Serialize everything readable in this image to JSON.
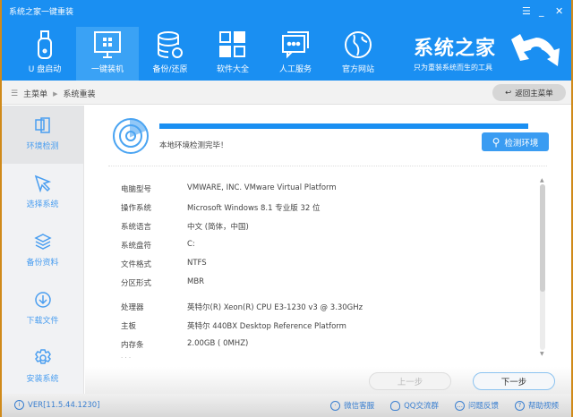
{
  "window": {
    "title": "系统之家一键重装",
    "menu_icon": "menu-icon",
    "min_icon": "minimize-icon",
    "close_icon": "close-icon"
  },
  "nav": [
    {
      "label": "U 盘启动",
      "icon": "usb-icon"
    },
    {
      "label": "一键装机",
      "icon": "monitor-windows-icon",
      "selected": true
    },
    {
      "label": "备份/还原",
      "icon": "database-restore-icon"
    },
    {
      "label": "软件大全",
      "icon": "apps-grid-icon"
    },
    {
      "label": "人工服务",
      "icon": "chat-icon"
    },
    {
      "label": "官方网站",
      "icon": "globe-icon"
    }
  ],
  "brand": {
    "name": "系统之家",
    "slogan": "只为重装系统而生的工具"
  },
  "breadcrumb": {
    "root": "主菜单",
    "current": "系统重装"
  },
  "back_button": "返回主菜单",
  "sidebar": [
    {
      "label": "环境检测",
      "icon": "devices-icon",
      "selected": true
    },
    {
      "label": "选择系统",
      "icon": "cursor-icon"
    },
    {
      "label": "备份资料",
      "icon": "layers-icon"
    },
    {
      "label": "下载文件",
      "icon": "download-icon"
    },
    {
      "label": "安装系统",
      "icon": "gear-icon"
    }
  ],
  "detection": {
    "progress_percent": 100,
    "status": "本地环境检测完毕！",
    "button": "检测环境"
  },
  "info": [
    {
      "k": "电脑型号",
      "v": "VMWARE, INC. VMware Virtual Platform"
    },
    {
      "k": "操作系统",
      "v": "Microsoft Windows 8.1 专业版 32 位"
    },
    {
      "k": "系统语言",
      "v": "中文 (简体，中国)"
    },
    {
      "k": "系统盘符",
      "v": "C:"
    },
    {
      "k": "文件格式",
      "v": "NTFS"
    },
    {
      "k": "分区形式",
      "v": "MBR"
    },
    {
      "k": "处理器",
      "v": "英特尔(R) Xeon(R) CPU E3-1230 v3 @ 3.30GHz"
    },
    {
      "k": "主板",
      "v": "英特尔 440BX Desktop Reference Platform"
    },
    {
      "k": "内存条",
      "v": "2.00GB (  0MHZ)"
    }
  ],
  "more": "· · ·",
  "buttons": {
    "prev": "上一步",
    "next": "下一步"
  },
  "footer": {
    "version": "VER[11.5.44.1230]",
    "links": [
      {
        "label": "微信客服",
        "icon": "wechat-icon"
      },
      {
        "label": "QQ交流群",
        "icon": "qq-icon"
      },
      {
        "label": "问题反馈",
        "icon": "feedback-icon"
      },
      {
        "label": "帮助视频",
        "icon": "help-icon"
      }
    ]
  },
  "colors": {
    "primary": "#1a8ff2",
    "sidebar_text": "#4a9ef0"
  }
}
